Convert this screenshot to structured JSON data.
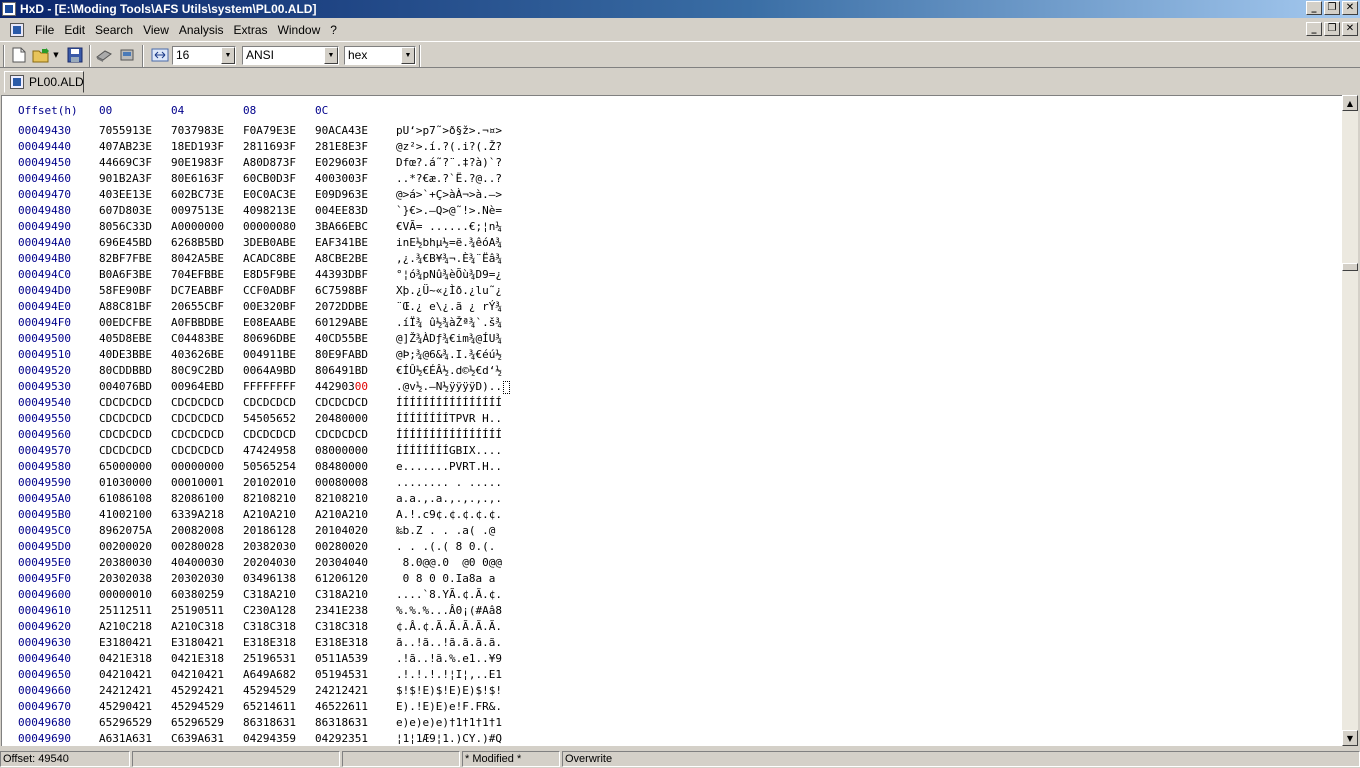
{
  "window": {
    "title": "HxD - [E:\\Moding Tools\\AFS Utils\\system\\PL00.ALD]"
  },
  "menu": {
    "items": [
      "File",
      "Edit",
      "Search",
      "View",
      "Analysis",
      "Extras",
      "Window",
      "?"
    ]
  },
  "toolbar": {
    "bytes_per_row": "16",
    "charset": "ANSI",
    "display_mode": "hex"
  },
  "tabs": [
    {
      "label": "PL00.ALD"
    }
  ],
  "hex": {
    "header": {
      "offset_label": "Offset(h)",
      "columns": [
        "00",
        "04",
        "08",
        "0C"
      ]
    },
    "rows": [
      {
        "offset": "00049430",
        "g": [
          "7055913E",
          "7037983E",
          "F0A79E3E",
          "90ACA43E"
        ],
        "ascii": "pU‘>p7˜>ð§ž>.¬¤>"
      },
      {
        "offset": "00049440",
        "g": [
          "407AB23E",
          "18ED193F",
          "2811693F",
          "281E8E3F"
        ],
        "ascii": "@z²>.í.?(.i?(.Ž?"
      },
      {
        "offset": "00049450",
        "g": [
          "44669C3F",
          "90E1983F",
          "A80D873F",
          "E029603F"
        ],
        "ascii": "Dfœ?.á˜?¨.‡?à)`?"
      },
      {
        "offset": "00049460",
        "g": [
          "901B2A3F",
          "80E6163F",
          "60CB0D3F",
          "4003003F"
        ],
        "ascii": "..*?€æ.?`Ë.?@..?"
      },
      {
        "offset": "00049470",
        "g": [
          "403EE13E",
          "602BC73E",
          "E0C0AC3E",
          "E09D963E"
        ],
        "ascii": "@>á>`+Ç>àÀ¬>à.–>"
      },
      {
        "offset": "00049480",
        "g": [
          "607D803E",
          "0097513E",
          "4098213E",
          "004EE83D"
        ],
        "ascii": "`}€>.—Q>@˜!>.Nè="
      },
      {
        "offset": "00049490",
        "g": [
          "8056C33D",
          "A0000000",
          "00000080",
          "3BA66EBC"
        ],
        "ascii": "€VÃ= ......€;¦n¼"
      },
      {
        "offset": "000494A0",
        "g": [
          "696E45BD",
          "6268B5BD",
          "3DEB0ABE",
          "EAF341BE"
        ],
        "ascii": "inE½bhµ½=ë.¾êóA¾"
      },
      {
        "offset": "000494B0",
        "g": [
          "82BF7FBE",
          "8042A5BE",
          "ACADC8BE",
          "A8CBE2BE"
        ],
        "ascii": "‚¿.¾€B¥¾¬.È¾¨Ëâ¾"
      },
      {
        "offset": "000494C0",
        "g": [
          "B0A6F3BE",
          "704EFBBE",
          "E8D5F9BE",
          "44393DBF"
        ],
        "ascii": "°¦ó¾pNû¾èÕù¾D9=¿"
      },
      {
        "offset": "000494D0",
        "g": [
          "58FE90BF",
          "DC7EABBF",
          "CCF0ADBF",
          "6C7598BF"
        ],
        "ascii": "Xþ.¿Ü~«¿Ìð.¿lu˜¿"
      },
      {
        "offset": "000494E0",
        "g": [
          "A88C81BF",
          "20655CBF",
          "00E320BF",
          "2072DDBE"
        ],
        "ascii": "¨Œ.¿ e\\¿.ã ¿ rÝ¾"
      },
      {
        "offset": "000494F0",
        "g": [
          "00EDCFBE",
          "A0FBBDBE",
          "E08EAABE",
          "60129ABE"
        ],
        "ascii": ".íÏ¾ û½¾àŽª¾`.š¾"
      },
      {
        "offset": "00049500",
        "g": [
          "405D8EBE",
          "C04483BE",
          "80696DBE",
          "40CD55BE"
        ],
        "ascii": "@]Ž¾ÀDƒ¾€im¾@ÍU¾"
      },
      {
        "offset": "00049510",
        "g": [
          "40DE3BBE",
          "403626BE",
          "004911BE",
          "80E9FABD"
        ],
        "ascii": "@Þ;¾@6&¾.I.¾€éú½"
      },
      {
        "offset": "00049520",
        "g": [
          "80CDDBBD",
          "80C9C2BD",
          "0064A9BD",
          "806491BD"
        ],
        "ascii": "€ÍÛ½€ÉÂ½.d©½€d‘½"
      },
      {
        "offset": "00049530",
        "g": [
          "004076BD",
          "00964EBD",
          "FFFFFFFF",
          "442903"
        ],
        "red": "00",
        "ascii": ".@v½.–N½ÿÿÿÿD)..",
        "cursor": true
      },
      {
        "offset": "00049540",
        "g": [
          "CDCDCDCD",
          "CDCDCDCD",
          "CDCDCDCD",
          "CDCDCDCD"
        ],
        "ascii": "ÍÍÍÍÍÍÍÍÍÍÍÍÍÍÍÍ"
      },
      {
        "offset": "00049550",
        "g": [
          "CDCDCDCD",
          "CDCDCDCD",
          "54505652",
          "20480000"
        ],
        "ascii": "ÍÍÍÍÍÍÍÍTPVR H.."
      },
      {
        "offset": "00049560",
        "g": [
          "CDCDCDCD",
          "CDCDCDCD",
          "CDCDCDCD",
          "CDCDCDCD"
        ],
        "ascii": "ÍÍÍÍÍÍÍÍÍÍÍÍÍÍÍÍ"
      },
      {
        "offset": "00049570",
        "g": [
          "CDCDCDCD",
          "CDCDCDCD",
          "47424958",
          "08000000"
        ],
        "ascii": "ÍÍÍÍÍÍÍÍGBIX...."
      },
      {
        "offset": "00049580",
        "g": [
          "65000000",
          "00000000",
          "50565254",
          "08480000"
        ],
        "ascii": "e.......PVRT.H.."
      },
      {
        "offset": "00049590",
        "g": [
          "01030000",
          "00010001",
          "20102010",
          "00080008"
        ],
        "ascii": "........ . ....."
      },
      {
        "offset": "000495A0",
        "g": [
          "61086108",
          "82086100",
          "82108210",
          "82108210"
        ],
        "ascii": "a.a.‚.a.‚.‚.‚.‚."
      },
      {
        "offset": "000495B0",
        "g": [
          "41002100",
          "6339A218",
          "A210A210",
          "A210A210"
        ],
        "ascii": "A.!.c9¢.¢.¢.¢.¢."
      },
      {
        "offset": "000495C0",
        "g": [
          "8962075A",
          "20082008",
          "20186128",
          "20104020"
        ],
        "ascii": "‰b.Z . . .a( .@ "
      },
      {
        "offset": "000495D0",
        "g": [
          "00200020",
          "00280028",
          "20382030",
          "00280020"
        ],
        "ascii": ". . .(.( 8 0.(. "
      },
      {
        "offset": "000495E0",
        "g": [
          "20380030",
          "40400030",
          "20204030",
          "20304040"
        ],
        "ascii": " 8.0@@.0  @0 0@@"
      },
      {
        "offset": "000495F0",
        "g": [
          "20302038",
          "20302030",
          "03496138",
          "61206120"
        ],
        "ascii": " 0 8 0 0.Ia8a a "
      },
      {
        "offset": "00049600",
        "g": [
          "00000010",
          "60380259",
          "C318A210",
          "C318A210"
        ],
        "ascii": "....`8.YÃ.¢.Ã.¢."
      },
      {
        "offset": "00049610",
        "g": [
          "25112511",
          "25190511",
          "C230A128",
          "2341E238"
        ],
        "ascii": "%.%.%...Â0¡(#Aâ8"
      },
      {
        "offset": "00049620",
        "g": [
          "A210C218",
          "A210C318",
          "C318C318",
          "C318C318"
        ],
        "ascii": "¢.Â.¢.Ã.Ã.Ã.Ã.Ã."
      },
      {
        "offset": "00049630",
        "g": [
          "E3180421",
          "E3180421",
          "E318E318",
          "E318E318"
        ],
        "ascii": "ã..!ã..!ã.ã.ã.ã."
      },
      {
        "offset": "00049640",
        "g": [
          "0421E318",
          "0421E318",
          "25196531",
          "0511A539"
        ],
        "ascii": ".!ã..!ã.%.e1..¥9"
      },
      {
        "offset": "00049650",
        "g": [
          "04210421",
          "04210421",
          "A649A682",
          "05194531"
        ],
        "ascii": ".!.!.!.!¦I¦‚..E1"
      },
      {
        "offset": "00049660",
        "g": [
          "24212421",
          "45292421",
          "45294529",
          "24212421"
        ],
        "ascii": "$!$!E)$!E)E)$!$!"
      },
      {
        "offset": "00049670",
        "g": [
          "45290421",
          "45294529",
          "65214611",
          "46522611"
        ],
        "ascii": "E).!E)E)e!F.FR&."
      },
      {
        "offset": "00049680",
        "g": [
          "65296529",
          "65296529",
          "86318631",
          "86318631"
        ],
        "ascii": "e)e)e)e)†1†1†1†1"
      },
      {
        "offset": "00049690",
        "g": [
          "A631A631",
          "C639A631",
          "04294359",
          "04292351"
        ],
        "ascii": "¦1¦1Æ9¦1.)CY.)#Q"
      }
    ]
  },
  "status": {
    "offset": "Offset: 49540",
    "panel2": "",
    "panel3": "",
    "modified": "* Modified *",
    "mode": "Overwrite"
  }
}
